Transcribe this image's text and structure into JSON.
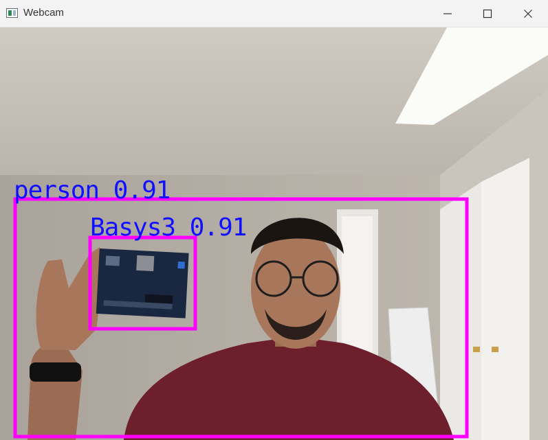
{
  "window": {
    "title": "Webcam",
    "controls": {
      "minimize": "minimize-icon",
      "maximize": "maximize-icon",
      "close": "close-icon"
    }
  },
  "detections": [
    {
      "label": "person 0.91",
      "color": "#ff00ff"
    },
    {
      "label": "Basys3 0.91",
      "color": "#ff00ff"
    }
  ],
  "colors": {
    "box": "#ff00ff",
    "label_text": "#1010ff"
  }
}
